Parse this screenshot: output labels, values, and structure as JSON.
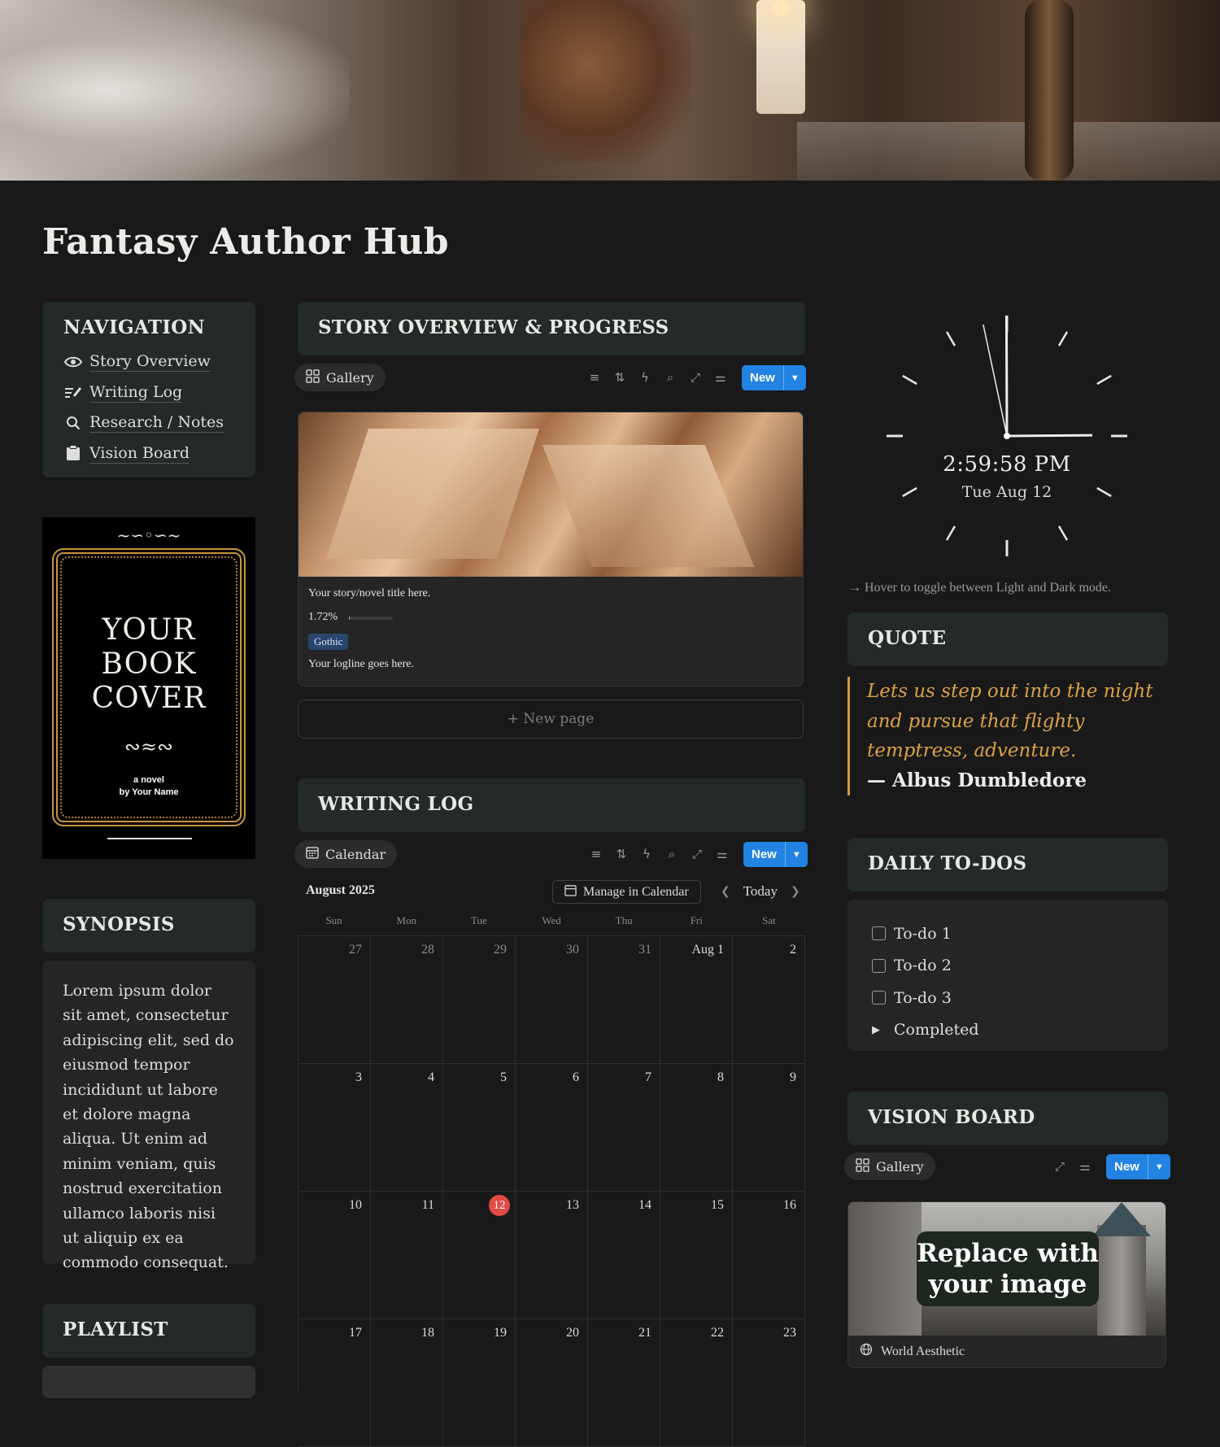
{
  "page": {
    "title": "Fantasy Author Hub"
  },
  "navigation": {
    "heading": "NAVIGATION",
    "items": [
      {
        "label": "Story Overview",
        "icon": "eye-icon"
      },
      {
        "label": "Writing Log",
        "icon": "pen-lines-icon"
      },
      {
        "label": "Research / Notes",
        "icon": "search-icon"
      },
      {
        "label": "Vision Board",
        "icon": "clipboard-icon"
      }
    ]
  },
  "book_cover": {
    "lines": [
      "YOUR",
      "BOOK",
      "COVER"
    ],
    "subtitle": "a novel",
    "author": "by Your Name",
    "accent_color": "#c8963e"
  },
  "synopsis": {
    "heading": "SYNOPSIS",
    "text": "Lorem ipsum dolor sit amet, consectetur adipiscing elit, sed do eiusmod tempor incididunt ut labore et dolore magna aliqua. Ut enim ad minim veniam, quis nostrud exercitation ullamco laboris nisi ut aliquip ex ea commodo consequat."
  },
  "playlist": {
    "heading": "PLAYLIST"
  },
  "story_overview": {
    "heading": "STORY OVERVIEW & PROGRESS",
    "view_label": "Gallery",
    "new_label": "New",
    "card": {
      "title": "Your story/novel title here.",
      "progress_text": "1.72%",
      "progress": 0.0172,
      "tag": "Gothic",
      "logline": "Your logline goes here."
    },
    "new_page_label": "+ New page"
  },
  "writing_log": {
    "heading": "WRITING LOG",
    "view_label": "Calendar",
    "new_label": "New",
    "month_label": "August 2025",
    "manage_label": "Manage in Calendar",
    "today_label": "Today",
    "weekdays": [
      "Sun",
      "Mon",
      "Tue",
      "Wed",
      "Thu",
      "Fri",
      "Sat"
    ],
    "days": [
      {
        "n": "27",
        "other": true
      },
      {
        "n": "28",
        "other": true
      },
      {
        "n": "29",
        "other": true
      },
      {
        "n": "30",
        "other": true
      },
      {
        "n": "31",
        "other": true
      },
      {
        "n": "Aug 1"
      },
      {
        "n": "2"
      },
      {
        "n": "3"
      },
      {
        "n": "4"
      },
      {
        "n": "5"
      },
      {
        "n": "6"
      },
      {
        "n": "7"
      },
      {
        "n": "8"
      },
      {
        "n": "9"
      },
      {
        "n": "10"
      },
      {
        "n": "11"
      },
      {
        "n": "12",
        "today": true
      },
      {
        "n": "13"
      },
      {
        "n": "14"
      },
      {
        "n": "15"
      },
      {
        "n": "16"
      },
      {
        "n": "17"
      },
      {
        "n": "18"
      },
      {
        "n": "19"
      },
      {
        "n": "20"
      },
      {
        "n": "21"
      },
      {
        "n": "22"
      },
      {
        "n": "23"
      }
    ]
  },
  "clock": {
    "time": "2:59:58 PM",
    "date": "Tue Aug 12",
    "hour": 2,
    "minute": 59,
    "second": 58,
    "hint": "→ Hover to toggle between Light and Dark mode."
  },
  "quote": {
    "heading": "QUOTE",
    "text": "Lets us step out into the night and pursue that flighty temptress, adventure.",
    "author": "— Albus Dumbledore",
    "color": "#d9a246"
  },
  "todos": {
    "heading": "DAILY TO-DOS",
    "items": [
      "To-do 1",
      "To-do 2",
      "To-do 3"
    ],
    "completed_label": "Completed"
  },
  "vision_board": {
    "heading": "VISION BOARD",
    "view_label": "Gallery",
    "new_label": "New",
    "card_image_text": "Replace with your image",
    "card_caption": "World Aesthetic"
  },
  "colors": {
    "background": "#191919",
    "panel": "#232a27",
    "accent_button": "#2383e2",
    "today_marker": "#e04b44",
    "tag": "#28456c"
  }
}
